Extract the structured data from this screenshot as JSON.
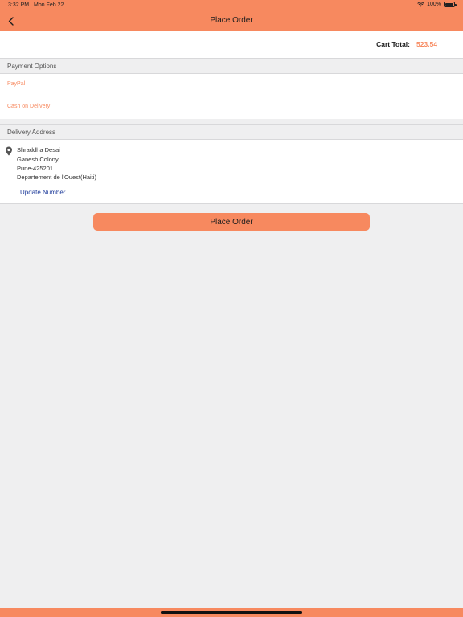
{
  "status_bar": {
    "time": "3:32 PM",
    "date": "Mon Feb 22",
    "battery": "100%"
  },
  "nav": {
    "title": "Place Order",
    "back_icon": "chevron-left-icon"
  },
  "cart": {
    "label": "Cart Total:",
    "value": "523.54"
  },
  "payment_section": {
    "header": "Payment Options",
    "options": [
      "PayPal",
      "Cash on Delivery"
    ]
  },
  "address_section": {
    "header": "Delivery Address",
    "icon": "map-pin-icon",
    "lines": [
      "Shraddha Desai",
      "Ganesh Colony,",
      "Pune-425201",
      "Departement de l'Ouest(Haiti)"
    ],
    "update_label": "Update Number"
  },
  "place_order": {
    "label": "Place Order"
  },
  "colors": {
    "accent": "#f7895f",
    "link": "#1c3a9a",
    "background": "#efeff0"
  }
}
